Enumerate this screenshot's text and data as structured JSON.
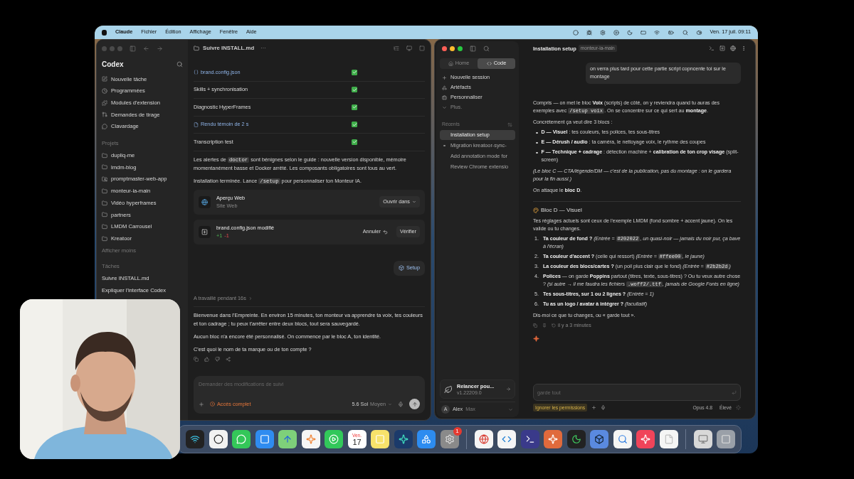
{
  "menubar": {
    "app": "Claude",
    "menus": [
      "Fichier",
      "Édition",
      "Affichage",
      "Fenêtre",
      "Aide"
    ],
    "clock": "Ven. 17 juil. 09:11"
  },
  "codex": {
    "sidebar": {
      "title": "Codex",
      "nav": [
        {
          "kind": "new",
          "label": "Nouvelle tâche"
        },
        {
          "kind": "clock",
          "label": "Programmées"
        },
        {
          "kind": "plugins",
          "label": "Modules d'extension"
        },
        {
          "kind": "pull",
          "label": "Demandes de tirage"
        },
        {
          "kind": "chat",
          "label": "Clavardage"
        }
      ],
      "projects_heading": "Projets",
      "projects": [
        {
          "kind": "folder",
          "label": "dupliq-me"
        },
        {
          "kind": "folder",
          "label": "lmdm-blog"
        },
        {
          "kind": "git",
          "label": "promptmaster-web-app"
        },
        {
          "kind": "folder",
          "label": "monteur-ia-main"
        },
        {
          "kind": "folder",
          "label": "Vidéo hyperframes"
        },
        {
          "kind": "folder",
          "label": "partners"
        },
        {
          "kind": "folder",
          "label": "LMDM Carrousel"
        },
        {
          "kind": "folder",
          "label": "Kreatoor"
        }
      ],
      "show_less": "Afficher moins",
      "tasks_heading": "Tâches",
      "tasks": [
        "Suivre INSTALL.md",
        "Expliquer l'interface Codex"
      ]
    },
    "title": "Suivre INSTALL.md",
    "more": "···",
    "checklist": [
      {
        "kind": "json",
        "label": "brand.config.json",
        "checked": true
      },
      {
        "kind": "text",
        "label": "Skills + synchronisation",
        "checked": true
      },
      {
        "kind": "text",
        "label": "Diagnostic HyperFrames",
        "checked": true
      },
      {
        "kind": "file",
        "label": "Rendu témoin de 2 s",
        "checked": true
      },
      {
        "kind": "text",
        "label": "Transcription test",
        "checked": true
      }
    ],
    "notes": [
      [
        {
          "kind": "plain",
          "text": "Les alertes de "
        },
        {
          "kind": "code",
          "text": "doctor"
        },
        {
          "kind": "plain",
          "text": " sont bénignes selon le guide : nouvelle version disponible, mémoire momentanément basse et Docker arrêté. Les composants obligatoires sont tous au vert."
        }
      ],
      [
        {
          "kind": "plain",
          "text": "Installation terminée. Lance "
        },
        {
          "kind": "code",
          "text": "/setup"
        },
        {
          "kind": "plain",
          "text": " pour personnaliser ton Monteur IA."
        }
      ]
    ],
    "preview_card": {
      "title": "Aperçu Web",
      "subtitle": "Site Web",
      "button": "Ouvrir dans"
    },
    "diff_card": {
      "title": "brand.config.json modifié",
      "added": "+1",
      "removed": "-1",
      "undo": "Annuler",
      "verify": "Vérifier"
    },
    "chip": "Setup",
    "worked": "A travaillé pendant 16s",
    "message": [
      "Bienvenue dans l'Empreinte. En environ 15 minutes, ton monteur va apprendre ta voix, tes couleurs et ton cadrage ; tu peux t'arrêter entre deux blocs, tout sera sauvegardé.",
      "Aucun bloc n'a encore été personnalisé. On commence par le bloc A, ton identité.",
      "C'est quoi le nom de ta marque ou de ton compte ?"
    ],
    "composer": {
      "placeholder": "Demander des modifications de suivi",
      "access": "Accès complet",
      "model": "5.6 Sol",
      "effort": "Moyen"
    }
  },
  "claude": {
    "sidebar": {
      "tabs": [
        {
          "kind": "home",
          "label": "Home",
          "selected": false
        },
        {
          "kind": "code",
          "label": "Code",
          "selected": true
        }
      ],
      "nav": [
        {
          "kind": "plus",
          "label": "Nouvelle session"
        },
        {
          "kind": "artifacts",
          "label": "Artéfacts"
        },
        {
          "kind": "customize",
          "label": "Personnaliser"
        },
        {
          "kind": "more",
          "label": "Plus."
        }
      ],
      "recents_heading": "Récents",
      "recents": [
        {
          "label": "Installation setup",
          "selected": true,
          "running": false
        },
        {
          "label": "Migration kreatoor-sync-",
          "selected": false,
          "running": true
        },
        {
          "label": "Add annotation mode for",
          "selected": false,
          "running": false
        },
        {
          "label": "Review Chrome extensio",
          "selected": false,
          "running": false
        }
      ],
      "update": {
        "title": "Relancer pou...",
        "version": "v1.22209.0"
      },
      "user": {
        "initial": "A",
        "name": "Alex",
        "plan": "Max"
      }
    },
    "title": "Installation setup",
    "branch": "monteur-ia-main",
    "user_message": "on verra plus tard pour cette partie script copncente toi sur le montage",
    "blocks": [
      {
        "kind": "para",
        "parts": [
          {
            "kind": "plain",
            "text": "Compris — on met le bloc "
          },
          {
            "kind": "bold",
            "text": "Voix"
          },
          {
            "kind": "plain",
            "text": " (scripts) de côté, on y reviendra quand tu auras des exemples avec "
          },
          {
            "kind": "code",
            "text": "/setup voix"
          },
          {
            "kind": "plain",
            "text": ". On se concentre sur ce qui sert au "
          },
          {
            "kind": "bold",
            "text": "montage"
          },
          {
            "kind": "plain",
            "text": "."
          }
        ]
      },
      {
        "kind": "para",
        "parts": [
          {
            "kind": "plain",
            "text": "Concrètement ça veut dire 3 blocs :"
          }
        ]
      },
      {
        "kind": "bullets",
        "items": [
          [
            {
              "kind": "bold",
              "text": "D — Visuel"
            },
            {
              "kind": "plain",
              "text": " : tes couleurs, tes polices, tes sous-titres"
            }
          ],
          [
            {
              "kind": "bold",
              "text": "E — Dérush / audio"
            },
            {
              "kind": "plain",
              "text": " : ta caméra, le nettoyage voix, le rythme des coupes"
            }
          ],
          [
            {
              "kind": "bold",
              "text": "F — Technique + cadrage"
            },
            {
              "kind": "plain",
              "text": " : détection machine + "
            },
            {
              "kind": "bold",
              "text": "calibration de ton crop visage"
            },
            {
              "kind": "plain",
              "text": " (split-screen)"
            }
          ]
        ]
      },
      {
        "kind": "para",
        "parts": [
          {
            "kind": "italic",
            "text": "(Le bloc C — CTA/légende/DM — c'est de la publication, pas du montage : on le gardera pour la fin aussi.)"
          }
        ]
      },
      {
        "kind": "para",
        "parts": [
          {
            "kind": "plain",
            "text": "On attaque le "
          },
          {
            "kind": "bold",
            "text": "bloc D"
          },
          {
            "kind": "plain",
            "text": "."
          }
        ]
      },
      {
        "kind": "divider"
      },
      {
        "kind": "heading",
        "text": "Bloc D — Visuel"
      },
      {
        "kind": "para",
        "parts": [
          {
            "kind": "plain",
            "text": "Tes réglages actuels sont ceux de l'exemple LMDM (fond sombre + accent jaune). On les valide ou tu changes."
          }
        ]
      },
      {
        "kind": "numbered",
        "items": [
          {
            "number": "1.",
            "parts": [
              {
                "kind": "bold",
                "text": "Ta couleur de fond ?"
              },
              {
                "kind": "italic",
                "text": " (Entrée = "
              },
              {
                "kind": "code",
                "text": "#202022"
              },
              {
                "kind": "italic",
                "text": ", un quasi-noir — jamais du noir pur, ça bave à l'écran)"
              }
            ]
          },
          {
            "number": "2.",
            "parts": [
              {
                "kind": "bold",
                "text": "Ta couleur d'accent ?"
              },
              {
                "kind": "plain",
                "text": " (celle qui ressort) "
              },
              {
                "kind": "italic",
                "text": "(Entrée = "
              },
              {
                "kind": "code",
                "text": "#ffee00"
              },
              {
                "kind": "italic",
                "text": ", le jaune)"
              }
            ]
          },
          {
            "number": "3.",
            "parts": [
              {
                "kind": "bold",
                "text": "La couleur des blocs/cartes ?"
              },
              {
                "kind": "plain",
                "text": " (un poil plus clair que le fond) "
              },
              {
                "kind": "italic",
                "text": "(Entrée = "
              },
              {
                "kind": "code",
                "text": "#2b2b2d"
              },
              {
                "kind": "italic",
                "text": ")"
              }
            ]
          },
          {
            "number": "4.",
            "parts": [
              {
                "kind": "bold",
                "text": "Polices"
              },
              {
                "kind": "plain",
                "text": " — on garde "
              },
              {
                "kind": "bold",
                "text": "Poppins"
              },
              {
                "kind": "plain",
                "text": " partout (titres, texte, sous-titres) ? Ou tu veux autre chose ? "
              },
              {
                "kind": "italic",
                "text": "(si autre → il me faudra les fichiers "
              },
              {
                "kind": "code",
                "text": ".woff2/.ttf"
              },
              {
                "kind": "italic",
                "text": ", jamais de Google Fonts en ligne)"
              }
            ]
          },
          {
            "number": "5.",
            "parts": [
              {
                "kind": "bold",
                "text": "Tes sous-titres, sur 1 ou 2 lignes ?"
              },
              {
                "kind": "italic",
                "text": " (Entrée = 1)"
              }
            ]
          },
          {
            "number": "6.",
            "parts": [
              {
                "kind": "bold",
                "text": "Tu as un logo / avatar à intégrer ?"
              },
              {
                "kind": "italic",
                "text": " (facultatif)"
              }
            ]
          }
        ]
      },
      {
        "kind": "para",
        "parts": [
          {
            "kind": "plain",
            "text": "Dis-moi ce que tu changes, ou « garde tout »."
          }
        ]
      }
    ],
    "timestamp": "il y a 3 minutes",
    "composer": {
      "placeholder": "garde tout",
      "permissions": "Ignorer les permissions",
      "model": "Opus 4.8",
      "effort": "Élevé"
    }
  },
  "dock": {
    "calendar_weekday": "Ven.",
    "calendar_day": "17",
    "badge": "1"
  }
}
